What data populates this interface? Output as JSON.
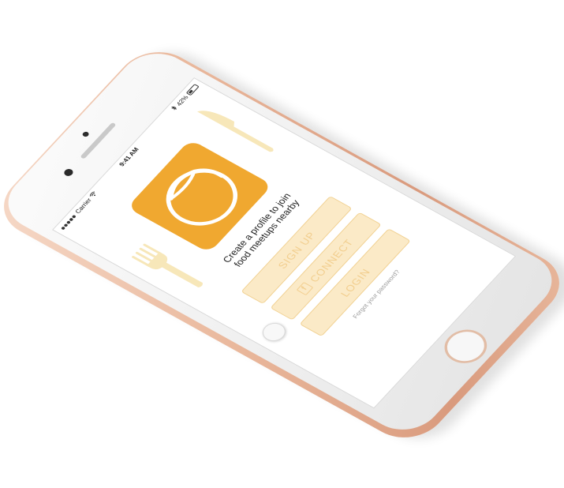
{
  "status_bar": {
    "carrier": "Carrier",
    "time": "9:41 AM",
    "battery": "42%"
  },
  "main": {
    "tagline_line1": "Create a profile to join",
    "tagline_line2": "food meetups nearby",
    "signup_label": "SIGN UP",
    "connect_label": "CONNECT",
    "login_label": "LOGIN",
    "forgot_password": "Forgot your password?"
  },
  "colors": {
    "accent": "#f0a830",
    "button_bg": "#fbeac7",
    "button_text": "#f2ce8e",
    "phone_frame": "#e9b79b",
    "cutlery": "#f7e7b9"
  },
  "icons": {
    "logo": "plate-logo-icon",
    "fork": "fork-icon",
    "knife": "knife-icon",
    "facebook": "facebook-icon",
    "wifi": "wifi-icon",
    "bluetooth": "bluetooth-icon",
    "battery": "battery-icon"
  }
}
